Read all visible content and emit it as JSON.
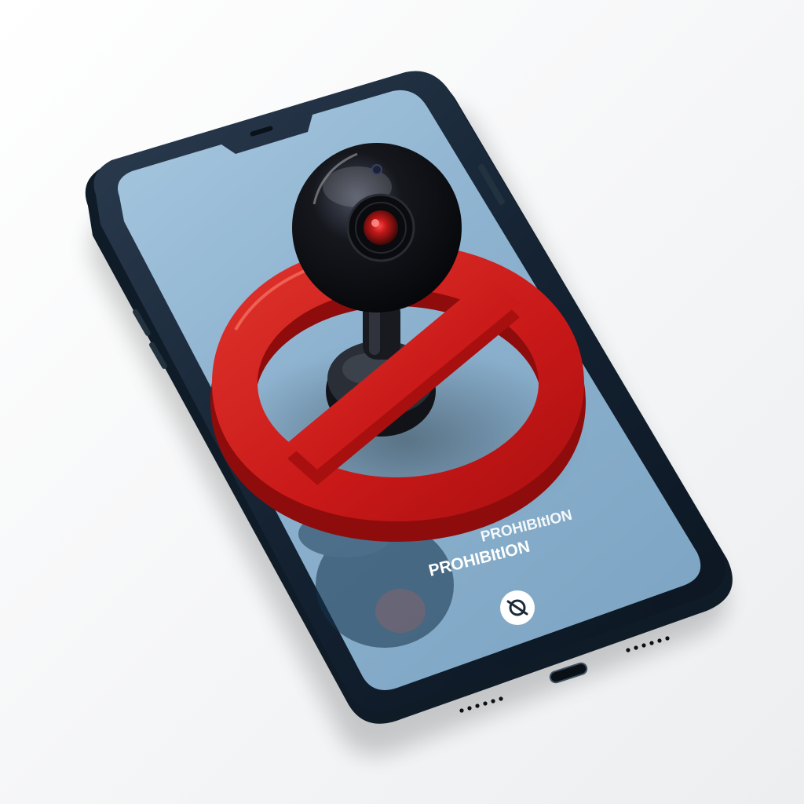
{
  "screen": {
    "upper_text": "PROHIBItION",
    "lower_text": "PROHIBItION"
  },
  "icons": {
    "prohibition_sign": "prohibition-sign-icon",
    "webcam": "webcam-icon",
    "screen_button": "no-camera-icon"
  },
  "colors": {
    "background": "#f4f5f6",
    "phone_frame": "#1b2a3a",
    "screen": "#8fb3cf",
    "prohibition_red": "#d01c1c",
    "webcam_body": "#0b0c10",
    "lens_red": "#e02020",
    "text": "#ffffff"
  }
}
